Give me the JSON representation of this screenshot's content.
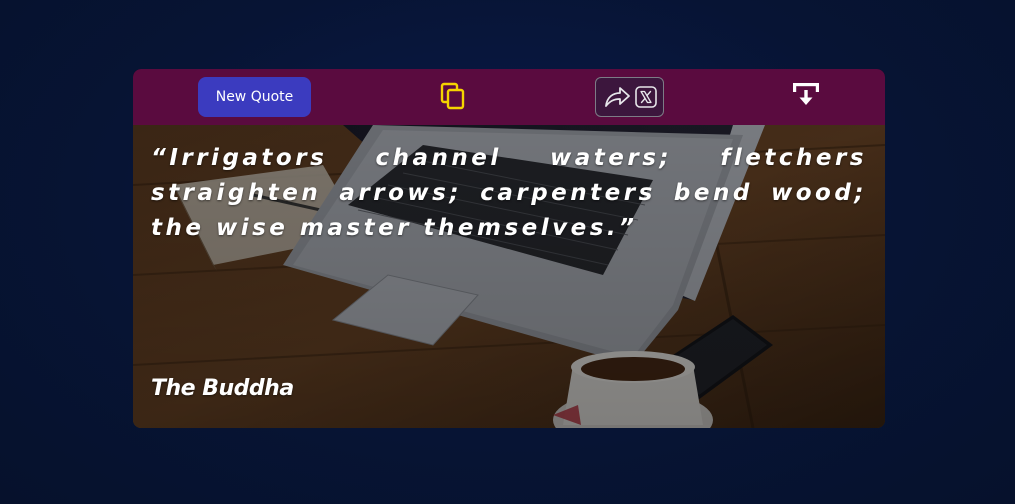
{
  "toolbar": {
    "new_quote_label": "New Quote",
    "copy_icon": "copy-icon",
    "share_icon": "share-arrow-icon",
    "x_icon": "x-logo-icon",
    "download_icon": "download-icon"
  },
  "quote": {
    "text": "“Irrigators channel waters; fletchers straighten arrows; carpenters bend wood; the wise master themselves.”",
    "author": "The Buddha"
  },
  "colors": {
    "page_background": "#071434",
    "toolbar_background": "#5a0b3f",
    "new_quote_button": "#3b3bbf",
    "copy_icon": "#f5d400",
    "text": "#ffffff"
  }
}
